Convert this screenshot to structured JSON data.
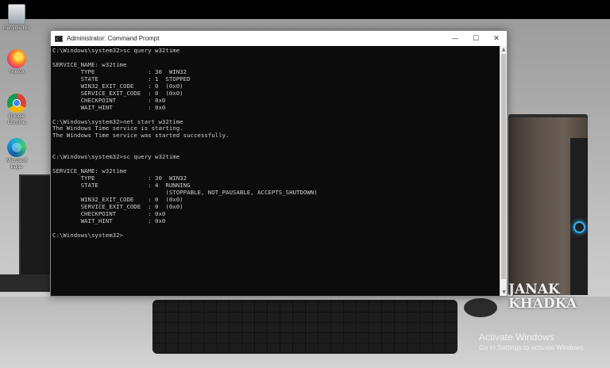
{
  "desktop": {
    "icons": [
      {
        "label": "Recycle Bin",
        "icon": "recycle-bin-icon"
      },
      {
        "label": "Firefox",
        "icon": "firefox-icon"
      },
      {
        "label": "Google Chrome",
        "icon": "chrome-icon"
      },
      {
        "label": "Microsoft Edge",
        "icon": "edge-icon"
      }
    ],
    "watermark": "JANAK\nKHADKA",
    "activation": {
      "title": "Activate Windows",
      "subtitle": "Go to Settings to activate Windows."
    }
  },
  "window": {
    "title": "Administrator: Command Prompt",
    "app_icon_text": "C:\\",
    "minimize": "—",
    "maximize": "☐",
    "close": "✕",
    "scroll_up": "▲",
    "scroll_down": "▼",
    "console_text": "C:\\Windows\\system32>sc query w32time\n\nSERVICE_NAME: w32time\n        TYPE               : 30  WIN32\n        STATE              : 1  STOPPED\n        WIN32_EXIT_CODE    : 0  (0x0)\n        SERVICE_EXIT_CODE  : 0  (0x0)\n        CHECKPOINT         : 0x0\n        WAIT_HINT          : 0x0\n\nC:\\Windows\\system32>net start w32time\nThe Windows Time service is starting.\nThe Windows Time service was started successfully.\n\n\nC:\\Windows\\system32>sc query w32time\n\nSERVICE_NAME: w32time\n        TYPE               : 30  WIN32\n        STATE              : 4  RUNNING\n                                (STOPPABLE, NOT_PAUSABLE, ACCEPTS_SHUTDOWN)\n        WIN32_EXIT_CODE    : 0  (0x0)\n        SERVICE_EXIT_CODE  : 0  (0x0)\n        CHECKPOINT         : 0x0\n        WAIT_HINT          : 0x0\n\nC:\\Windows\\system32>"
  },
  "colors": {
    "console_bg": "#0c0c0c",
    "console_text": "#cccccc",
    "titlebar_bg": "#ffffff",
    "power_led": "#2fb3ff"
  }
}
